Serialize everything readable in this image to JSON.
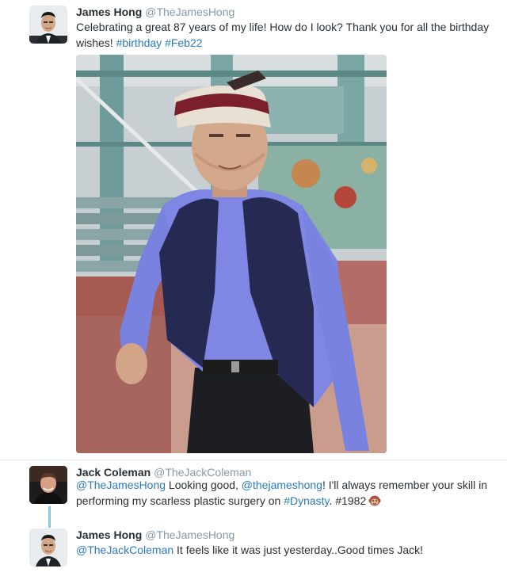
{
  "tweets": [
    {
      "name": "James Hong",
      "handle": "@TheJamesHong",
      "text_parts": {
        "a": "Celebrating a great 87 years of my life! How do I look? Thank you for all the birthday wishes! ",
        "tag1": "#birthday",
        "space": " ",
        "tag2": "#Feb22"
      }
    },
    {
      "name": "Jack Coleman",
      "handle": "@TheJackColeman",
      "text_parts": {
        "m1": "@TheJamesHong",
        "a": " Looking good, ",
        "m2": "@thejameshong",
        "b": "! I'll always remember your skill in performing my scarless plastic surgery on ",
        "tag": "#Dynasty",
        "c": ". #1982"
      }
    },
    {
      "name": "James Hong",
      "handle": "@TheJamesHong",
      "text_parts": {
        "m1": "@TheJackColeman",
        "a": " It feels like it was just yesterday..Good times Jack!"
      }
    }
  ],
  "colors": {
    "link": "#2b7bb9",
    "handle": "#8899a6",
    "thread_line": "#86c4e8",
    "text": "#292f33"
  },
  "icons": {
    "emoji": "monkey-face-emoji"
  }
}
